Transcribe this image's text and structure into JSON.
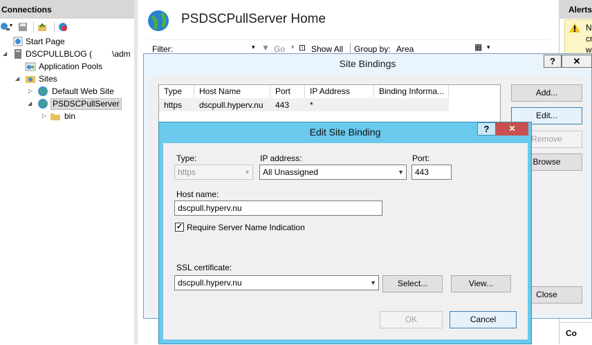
{
  "connections": {
    "title": "Connections",
    "tree": [
      {
        "label": "Start Page"
      },
      {
        "label": "DSCPULLBLOG (",
        "suffix": "\\adm"
      },
      {
        "label": "Application Pools"
      },
      {
        "label": "Sites"
      },
      {
        "label": "Default Web Site"
      },
      {
        "label": "PSDSCPullServer"
      },
      {
        "label": "bin"
      }
    ]
  },
  "home": {
    "title": "PSDSCPullServer Home",
    "filter_label": "Filter:",
    "go_label": "Go",
    "show_all_label": "Show All",
    "group_by_label": "Group by:",
    "group_by_value": "Area"
  },
  "alerts": {
    "title": "Alerts",
    "lines": [
      "N",
      "cr",
      "w"
    ],
    "bottom_text": "Co"
  },
  "site_bindings": {
    "title": "Site Bindings",
    "help_label": "?",
    "close_label": "✕",
    "columns": [
      "Type",
      "Host Name",
      "Port",
      "IP Address",
      "Binding Informa..."
    ],
    "rows": [
      {
        "type": "https",
        "host": "dscpull.hyperv.nu",
        "port": "443",
        "ip": "*",
        "info": ""
      }
    ],
    "buttons": {
      "add": "Add...",
      "edit": "Edit...",
      "remove": "Remove",
      "browse": "Browse",
      "close": "Close"
    }
  },
  "edit_binding": {
    "title": "Edit Site Binding",
    "help_label": "?",
    "close_label": "✕",
    "type_label": "Type:",
    "type_value": "https",
    "ip_label": "IP address:",
    "ip_value": "All Unassigned",
    "port_label": "Port:",
    "port_value": "443",
    "host_label": "Host name:",
    "host_value": "dscpull.hyperv.nu",
    "sni_label": "Require Server Name Indication",
    "sni_checked": true,
    "ssl_label": "SSL certificate:",
    "ssl_value": "dscpull.hyperv.nu",
    "select_label": "Select...",
    "view_label": "View...",
    "ok_label": "OK",
    "cancel_label": "Cancel"
  }
}
